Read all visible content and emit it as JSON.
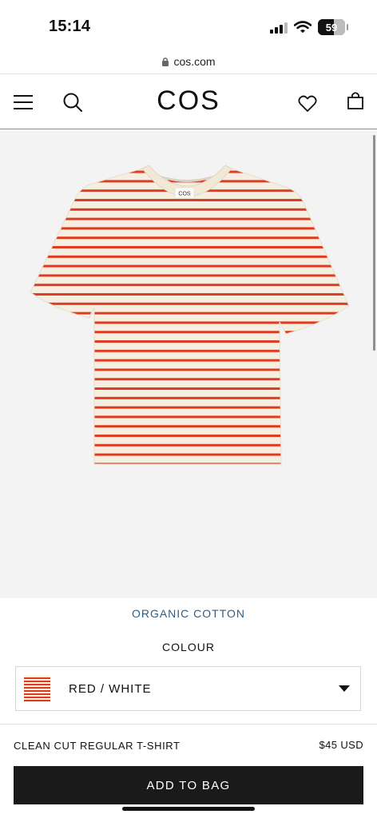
{
  "status_bar": {
    "time": "15:14",
    "battery_level": "59",
    "battery_fraction": 0.59
  },
  "browser": {
    "url": "cos.com"
  },
  "header": {
    "logo": "COS"
  },
  "product": {
    "image_label": "COS",
    "material": "ORGANIC COTTON",
    "colour_label": "COLOUR",
    "colour_selected": "RED / WHITE",
    "name": "CLEAN CUT REGULAR T-SHIRT",
    "price": "$45 USD",
    "add_to_bag_label": "ADD TO BAG"
  },
  "icons": {
    "menu": "hamburger-menu-icon",
    "search": "search-icon",
    "wishlist": "heart-icon",
    "bag": "shopping-bag-icon",
    "lock": "lock-icon",
    "dropdown": "chevron-down-icon"
  },
  "colors": {
    "stripe_red": "#e03a22",
    "stripe_white": "#f4eee0",
    "material_link": "#345c80",
    "button_bg": "#1a1a1a"
  }
}
